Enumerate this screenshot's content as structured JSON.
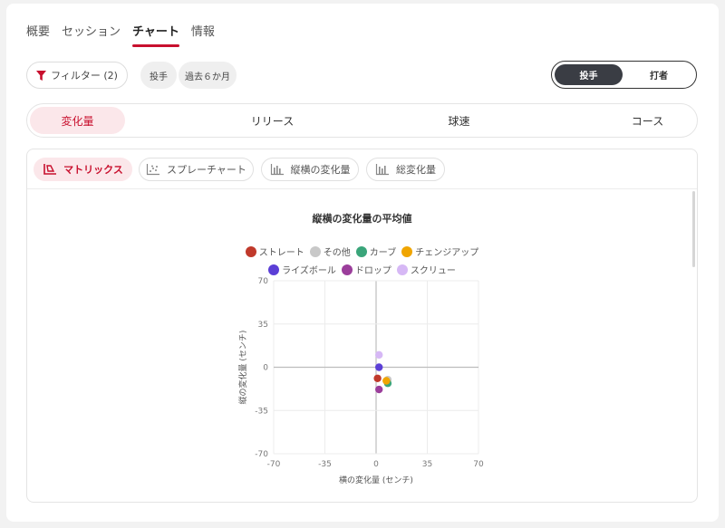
{
  "tabs": [
    {
      "label": "概要",
      "active": false
    },
    {
      "label": "セッション",
      "active": false
    },
    {
      "label": "チャート",
      "active": true
    },
    {
      "label": "情報",
      "active": false
    }
  ],
  "filter": {
    "label": "フィルター (2)"
  },
  "chips": [
    "投手",
    "過去６か月"
  ],
  "toggle": {
    "options": [
      "投手",
      "打者"
    ],
    "selected": "投手"
  },
  "subnav": {
    "items": [
      "変化量",
      "リリース",
      "球速",
      "コース"
    ],
    "selected": "変化量"
  },
  "panel_tabs": {
    "items": [
      "マトリックス",
      "スプレーチャート",
      "縦横の変化量",
      "総変化量"
    ],
    "selected": "マトリックス"
  },
  "colors": {
    "accent": "#c8102e",
    "active_bg": "#fbe7ea"
  },
  "chart_data": {
    "type": "scatter",
    "title": "縦横の変化量の平均値",
    "xlabel": "横の変化量 (センチ)",
    "ylabel": "縦の変化量 (センチ)",
    "xlim": [
      -70,
      70
    ],
    "ylim": [
      -70,
      70
    ],
    "xticks": [
      -70,
      -35,
      0,
      35,
      70
    ],
    "yticks": [
      -70,
      -35,
      0,
      35,
      70
    ],
    "grid": true,
    "legend_position": "top",
    "series": [
      {
        "name": "ストレート",
        "color": "#c0392b",
        "x": 1,
        "y": -9
      },
      {
        "name": "その他",
        "color": "#c8c8c8",
        "x": 8,
        "y": -10
      },
      {
        "name": "カーブ",
        "color": "#3aa57a",
        "x": 8,
        "y": -13
      },
      {
        "name": "チェンジアップ",
        "color": "#f0a500",
        "x": 7,
        "y": -11
      },
      {
        "name": "ライズボール",
        "color": "#5b3fd6",
        "x": 2,
        "y": 0
      },
      {
        "name": "ドロップ",
        "color": "#9b3e9b",
        "x": 2,
        "y": -18
      },
      {
        "name": "スクリュー",
        "color": "#d6b8f5",
        "x": 2,
        "y": 10
      }
    ]
  }
}
